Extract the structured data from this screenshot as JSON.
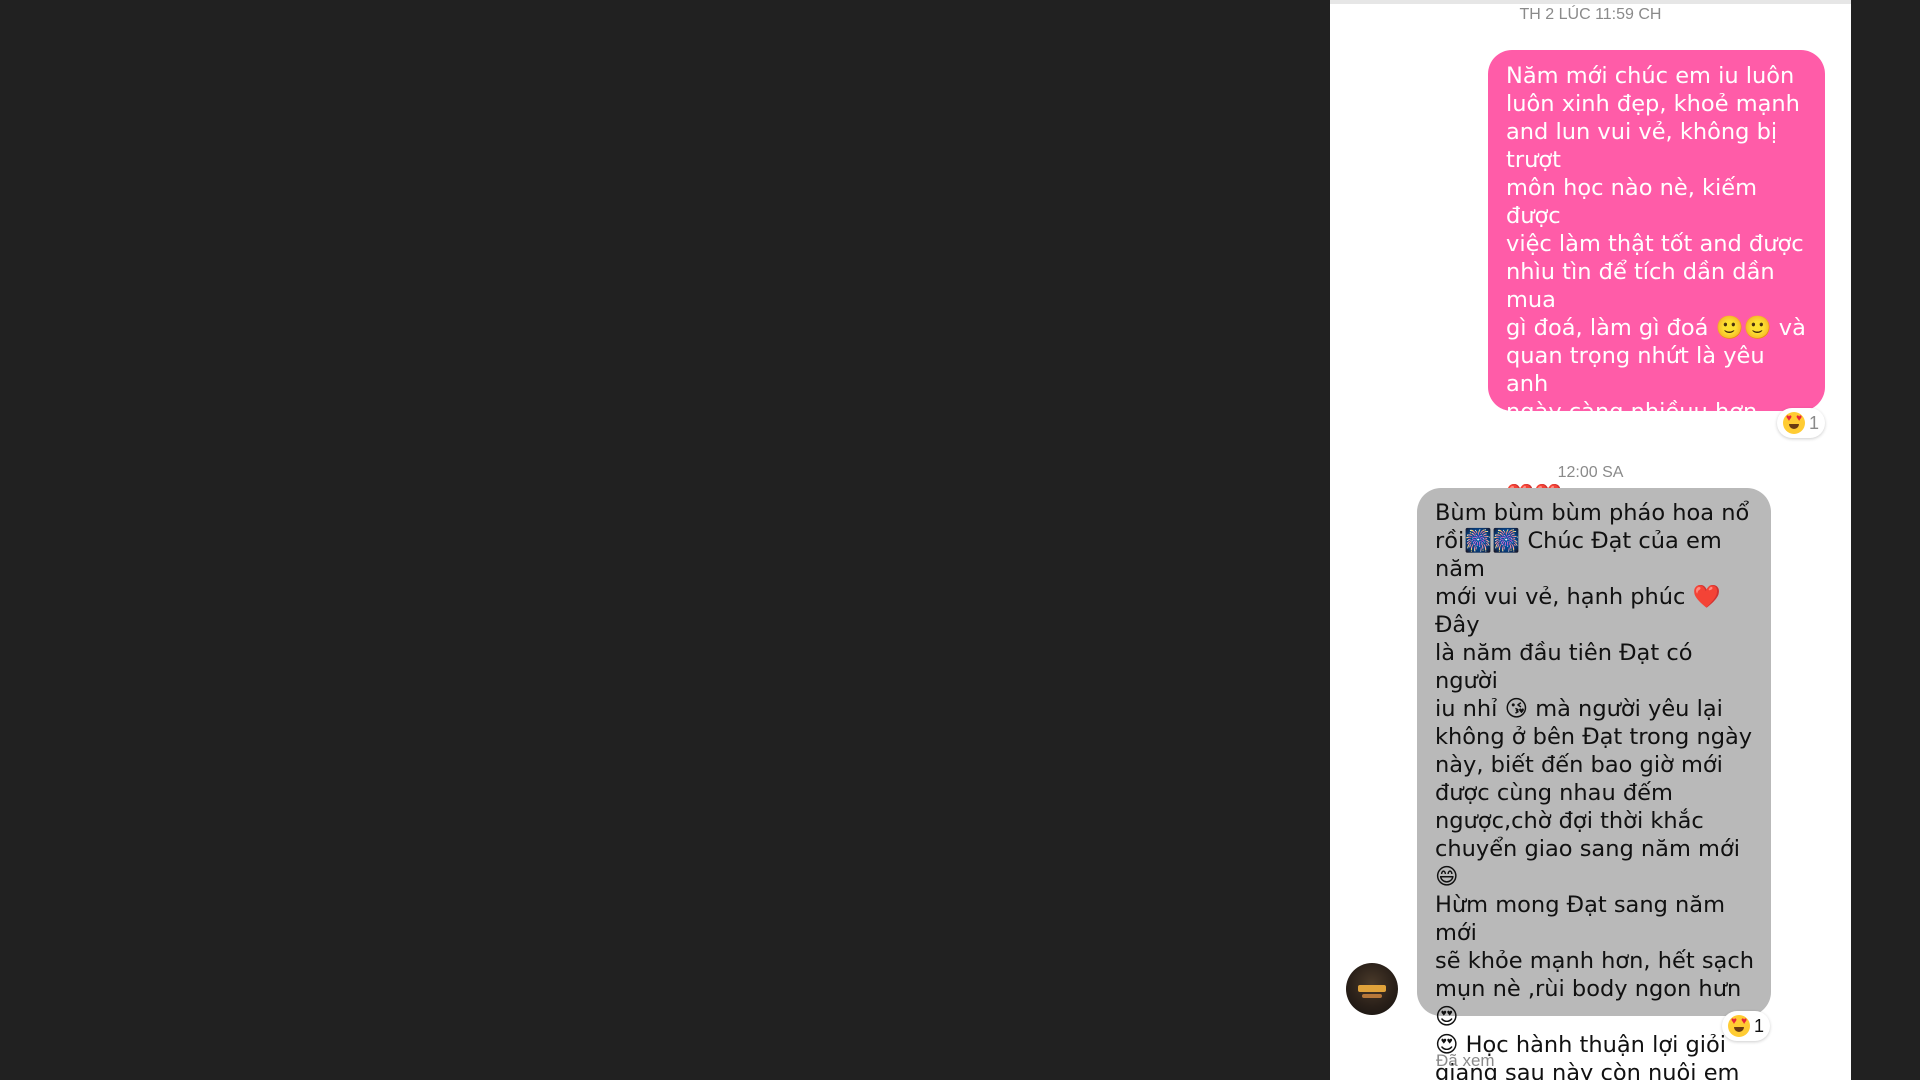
{
  "chat": {
    "timestamp_1": "TH 2 LÚC 11:59 CH",
    "timestamp_2": "12:00 SA",
    "outgoing_message": "Năm mới chúc em iu luôn\nluôn xinh đẹp, khoẻ mạnh\nand lun vui vẻ, không bị trượt\nmôn học nào nè, kiếm được\nviệc làm thật tốt and được\nnhìu tìn để tích dần dần mua\ngì đoá, làm gì đoá 🙂🙂 và\nquan trọng nhứt là yêu anh\nngày càng nhiềuu hơn nhaa,\nanh yêu em lắm ấyyy 😘😘\n❤️❤️ thật hạnh phúc khi\nđược yêu emm 💖😍.",
    "incoming_message": "Bùm bùm bùm pháo hoa nổ\nrồi🎆🎆 Chúc Đạt của em năm\nmới vui vẻ, hạnh phúc ❤️Đây\nlà năm đầu tiên Đạt có người\niu nhỉ 😘 mà người yêu lại\nkhông ở bên Đạt trong ngày\nnày, biết đến bao giờ mới\nđược cùng nhau đếm\nngược,chờ đợi thời khắc\nchuyển giao sang năm mới 😄\nHừm mong Đạt sang năm mới\nsẽ khỏe mạnh hơn, hết sạch\nmụn nè ,rùi body ngon hưn😍\n😍 Học hành thuận lợi giỏi\ngiang sau này còn nuôi em 😄\nEm yêu Đạt nhiều nhiều. Hy\nvọng Đạt sẽ mãi ở bên em.\nThương anh nhớ anh.",
    "reaction_1_count": "1",
    "reaction_2_count": "1",
    "seen_label": "Đã xem",
    "reaction_icon": "heart-eyes-icon",
    "colors": {
      "outgoing_bubble": "#ff5ca8",
      "incoming_bubble": "#b9b9b9",
      "background": "#212121"
    }
  }
}
